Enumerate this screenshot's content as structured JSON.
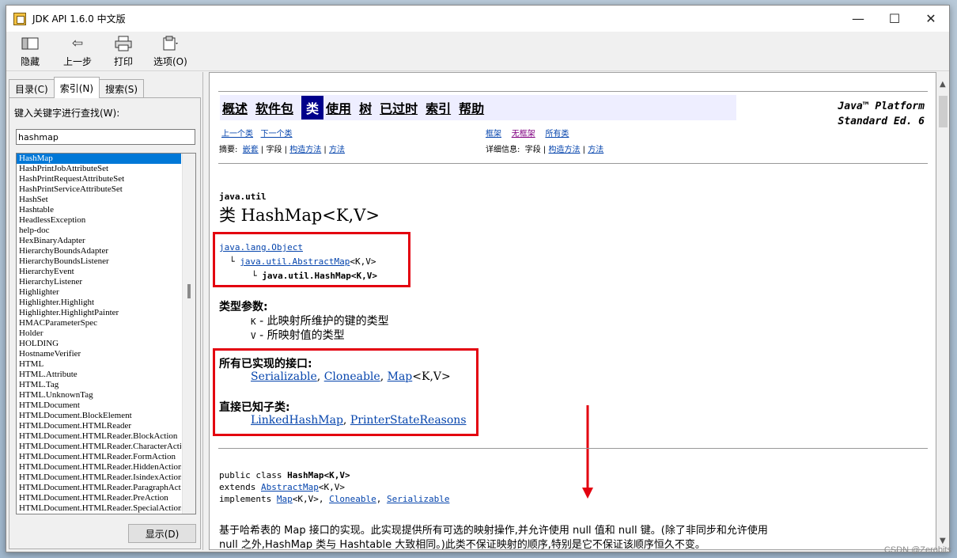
{
  "window": {
    "title": "JDK API 1.6.0 中文版",
    "minimize": "—",
    "maximize": "☐",
    "close": "✕"
  },
  "toolbar": {
    "hide": "隐藏",
    "back": "上一步",
    "print": "打印",
    "options": "选项(O)"
  },
  "tabs": {
    "contents": "目录(C)",
    "index": "索引(N)",
    "search": "搜索(S)",
    "active": "索引(N)"
  },
  "index": {
    "label": "键入关键字进行查找(W):",
    "query": "hashmap",
    "items": [
      "HashMap",
      "HashPrintJobAttributeSet",
      "HashPrintRequestAttributeSet",
      "HashPrintServiceAttributeSet",
      "HashSet",
      "Hashtable",
      "HeadlessException",
      "help-doc",
      "HexBinaryAdapter",
      "HierarchyBoundsAdapter",
      "HierarchyBoundsListener",
      "HierarchyEvent",
      "HierarchyListener",
      "Highlighter",
      "Highlighter.Highlight",
      "Highlighter.HighlightPainter",
      "HMACParameterSpec",
      "Holder",
      "HOLDING",
      "HostnameVerifier",
      "HTML",
      "HTML.Attribute",
      "HTML.Tag",
      "HTML.UnknownTag",
      "HTMLDocument",
      "HTMLDocument.BlockElement",
      "HTMLDocument.HTMLReader",
      "HTMLDocument.HTMLReader.BlockAction",
      "HTMLDocument.HTMLReader.CharacterActio",
      "HTMLDocument.HTMLReader.FormAction",
      "HTMLDocument.HTMLReader.HiddenAction",
      "HTMLDocument.HTMLReader.IsindexAction",
      "HTMLDocument.HTMLReader.ParagraphActic",
      "HTMLDocument.HTMLReader.PreAction",
      "HTMLDocument.HTMLReader.SpecialAction"
    ],
    "selected": "HashMap",
    "display_button": "显示(D)"
  },
  "doc": {
    "nav": [
      "概述",
      "软件包",
      "类",
      "使用",
      "树",
      "已过时",
      "索引",
      "帮助"
    ],
    "nav_current": "类",
    "platform_line1": "Java™ Platform",
    "platform_line2": "Standard Ed. 6",
    "prev_class": "上一个类",
    "next_class": "下一个类",
    "frames": "框架",
    "no_frames": "无框架",
    "all_classes": "所有类",
    "summary_label": "摘要:",
    "summary_nested": "嵌套",
    "summary_field": "字段",
    "summary_ctor": "构造方法",
    "summary_method": "方法",
    "detail_label": "详细信息:",
    "sep": "|",
    "package": "java.util",
    "class_title": "类 HashMap<K,V>",
    "hierarchy": {
      "root": "java.lang.Object",
      "mid": "java.util.AbstractMap",
      "mid_params": "<K,V>",
      "leaf": "java.util.HashMap<K,V>",
      "branch": "└"
    },
    "type_params_heading": "类型参数:",
    "type_param_k_name": "K",
    "type_param_k_desc": " - 此映射所维护的键的类型",
    "type_param_v_name": "V",
    "type_param_v_desc": " - 所映射值的类型",
    "interfaces_heading": "所有已实现的接口:",
    "interfaces": [
      "Serializable",
      "Cloneable",
      "Map"
    ],
    "map_params": "<K,V>",
    "comma": ",",
    "subclasses_heading": "直接已知子类:",
    "subclasses": [
      "LinkedHashMap",
      "PrinterStateReasons"
    ],
    "decl_public": "public class ",
    "decl_name": "HashMap<K,V>",
    "decl_extends": "extends ",
    "decl_super": "AbstractMap",
    "decl_super_params": "<K,V>",
    "decl_implements": "implements ",
    "decl_impl1": "Map",
    "decl_impl1_params": "<K,V>",
    "decl_impl2": "Cloneable",
    "decl_impl3": "Serializable",
    "desc_line1": "基于哈希表的 Map 接口的实现。此实现提供所有可选的映射操作,并允许使用 null 值和 null 键。(除了非同步和允许使用",
    "desc_line2": "null 之外,HashMap 类与 Hashtable 大致相同。)此类不保证映射的顺序,特别是它不保证该顺序恒久不变。"
  },
  "colors": {
    "annotation": "#e3000f",
    "link": "#0645ad",
    "selection": "#0078d7",
    "nav_bg": "#eeeeff",
    "nav_current": "#00008b"
  },
  "watermark": "CSDN @Zerobits"
}
